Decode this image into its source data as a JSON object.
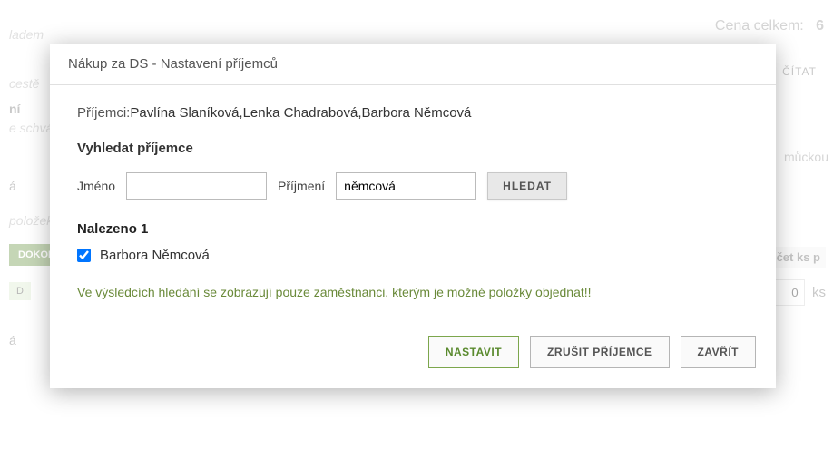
{
  "bg": {
    "row1": "ladem",
    "row2": " cestě",
    "row3": "ní",
    "row4": "e schvále",
    "row5": "á",
    "row6": "položek:",
    "row7": "á",
    "dokon": "DOKON",
    "d": "D",
    "cena": "Cena celkem:",
    "cena_val": "6",
    "citat": "ČÍTAT",
    "muckou": "můckou",
    "pocet_header": "očet ks p",
    "qty_val": "0",
    "ks": "ks"
  },
  "modal": {
    "title": "Nákup za DS - Nastavení příjemců",
    "recipients_label": "Příjemci:",
    "recipients_value": "Pavlína Slaníková,Lenka Chadrabová,Barbora Němcová",
    "search_title": "Vyhledat příjemce",
    "jmeno_label": "Jméno",
    "jmeno_value": "",
    "prijmeni_label": "Příjmení",
    "prijmeni_value": "němcová",
    "search_btn": "HLEDAT",
    "found_title": "Nalezeno 1",
    "result_name": "Barbora Němcová",
    "result_checked": true,
    "info": "Ve výsledcích hledání se zobrazují pouze zaměstnanci, kterým je možné položky objednat!!",
    "btn_set": "NASTAVIT",
    "btn_cancel": "ZRUŠIT PŘÍJEMCE",
    "btn_close": "ZAVŘÍT"
  }
}
